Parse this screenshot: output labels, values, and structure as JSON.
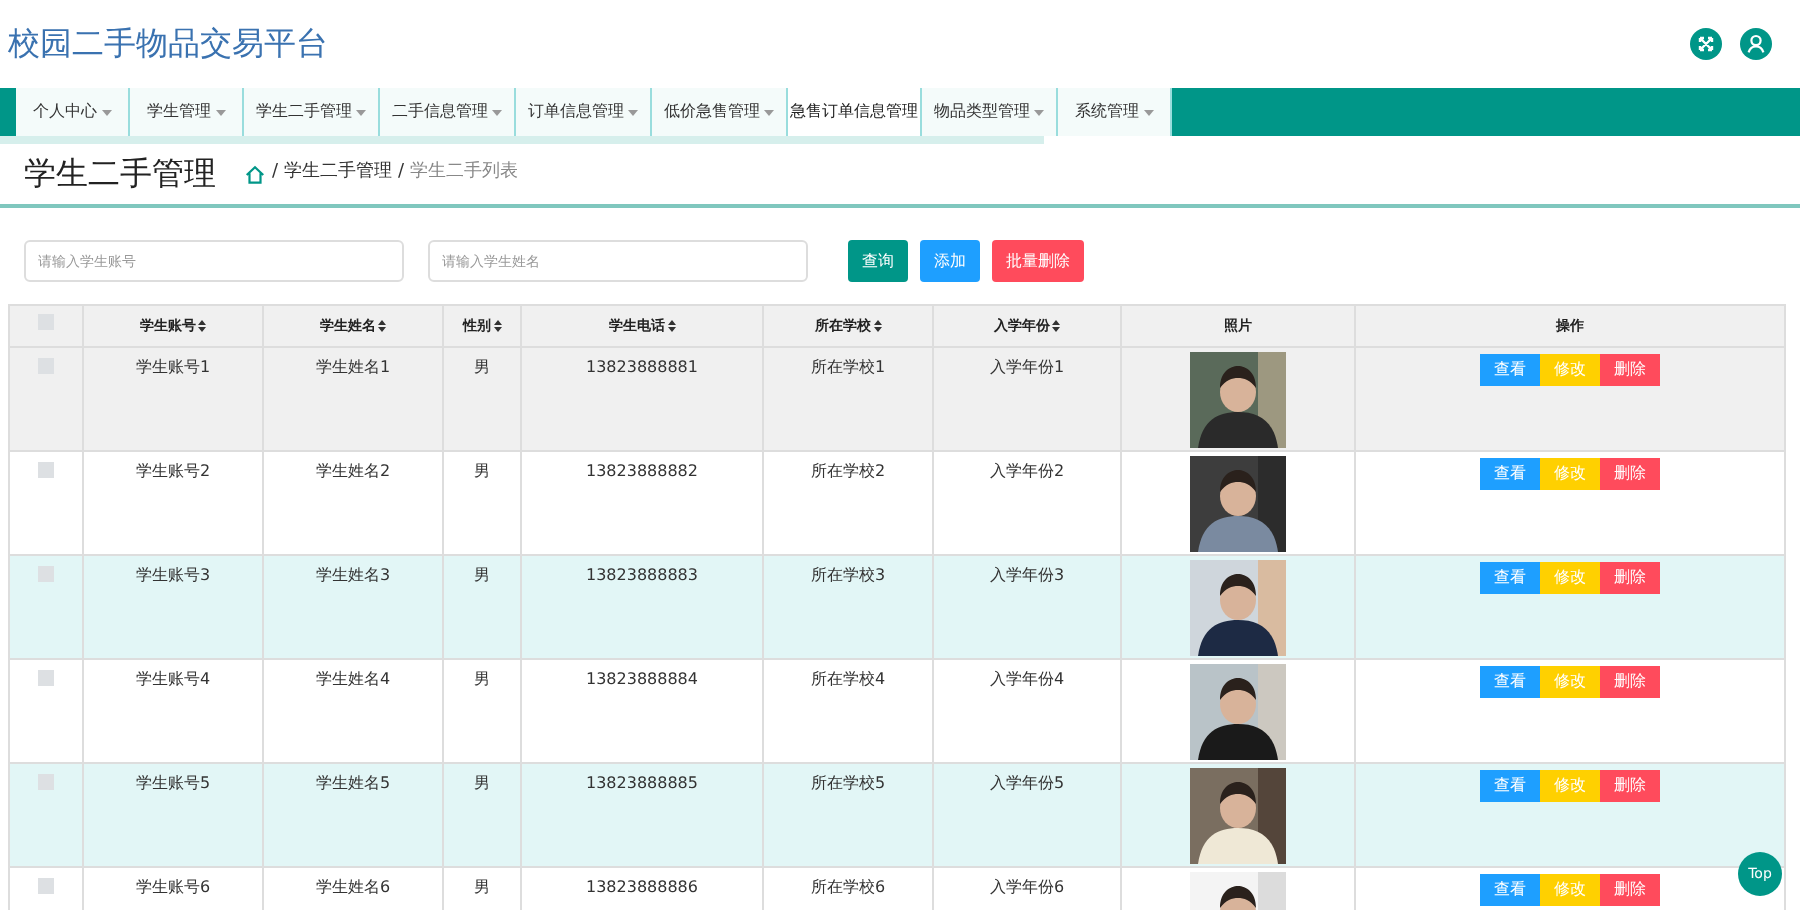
{
  "header": {
    "title": "校园二手物品交易平台"
  },
  "nav": [
    {
      "label": "个人中心",
      "selected": false
    },
    {
      "label": "学生管理",
      "selected": false
    },
    {
      "label": "学生二手管理",
      "selected": false
    },
    {
      "label": "二手信息管理",
      "selected": false
    },
    {
      "label": "订单信息管理",
      "selected": false
    },
    {
      "label": "低价急售管理",
      "selected": false
    },
    {
      "label": "急售订单信息管理",
      "selected": true
    },
    {
      "label": "物品类型管理",
      "selected": false
    },
    {
      "label": "系统管理",
      "selected": false
    }
  ],
  "page_title": "学生二手管理",
  "breadcrumb": [
    {
      "separator": "/",
      "label": "学生二手管理"
    },
    {
      "separator": "/",
      "label": "学生二手列表"
    }
  ],
  "search": [
    {
      "placeholder": "请输入学生账号"
    },
    {
      "placeholder": "请输入学生姓名"
    }
  ],
  "buttons": [
    {
      "label": "查询",
      "kind": "search"
    },
    {
      "label": "添加",
      "kind": "add"
    },
    {
      "label": "批量删除",
      "kind": "delete"
    }
  ],
  "table": {
    "select_all_checked": false,
    "columns": [
      "学生账号",
      "学生姓名",
      "性别",
      "学生电话",
      "所在学校",
      "入学年份",
      "照片",
      "操作"
    ],
    "rows": [
      {
        "checked": false,
        "hovered": true,
        "cells": [
          "学生账号1",
          "学生姓名1",
          "男",
          "13823888881",
          "所在学校1",
          "入学年份1"
        ],
        "actions": [
          "查看",
          "修改",
          "删除"
        ]
      },
      {
        "checked": false,
        "hovered": false,
        "cells": [
          "学生账号2",
          "学生姓名2",
          "男",
          "13823888882",
          "所在学校2",
          "入学年份2"
        ],
        "actions": [
          "查看",
          "修改",
          "删除"
        ]
      },
      {
        "checked": false,
        "hovered": false,
        "cells": [
          "学生账号3",
          "学生姓名3",
          "男",
          "13823888883",
          "所在学校3",
          "入学年份3"
        ],
        "actions": [
          "查看",
          "修改",
          "删除"
        ]
      },
      {
        "checked": false,
        "hovered": false,
        "cells": [
          "学生账号4",
          "学生姓名4",
          "男",
          "13823888884",
          "所在学校4",
          "入学年份4"
        ],
        "actions": [
          "查看",
          "修改",
          "删除"
        ]
      },
      {
        "checked": false,
        "hovered": false,
        "cells": [
          "学生账号5",
          "学生姓名5",
          "男",
          "13823888885",
          "所在学校5",
          "入学年份5"
        ],
        "actions": [
          "查看",
          "修改",
          "删除"
        ]
      },
      {
        "checked": false,
        "hovered": false,
        "cells": [
          "学生账号6",
          "学生姓名6",
          "男",
          "13823888886",
          "所在学校6",
          "入学年份6"
        ],
        "actions": [
          "查看",
          "修改",
          "删除"
        ]
      }
    ]
  },
  "top_button": "Top"
}
